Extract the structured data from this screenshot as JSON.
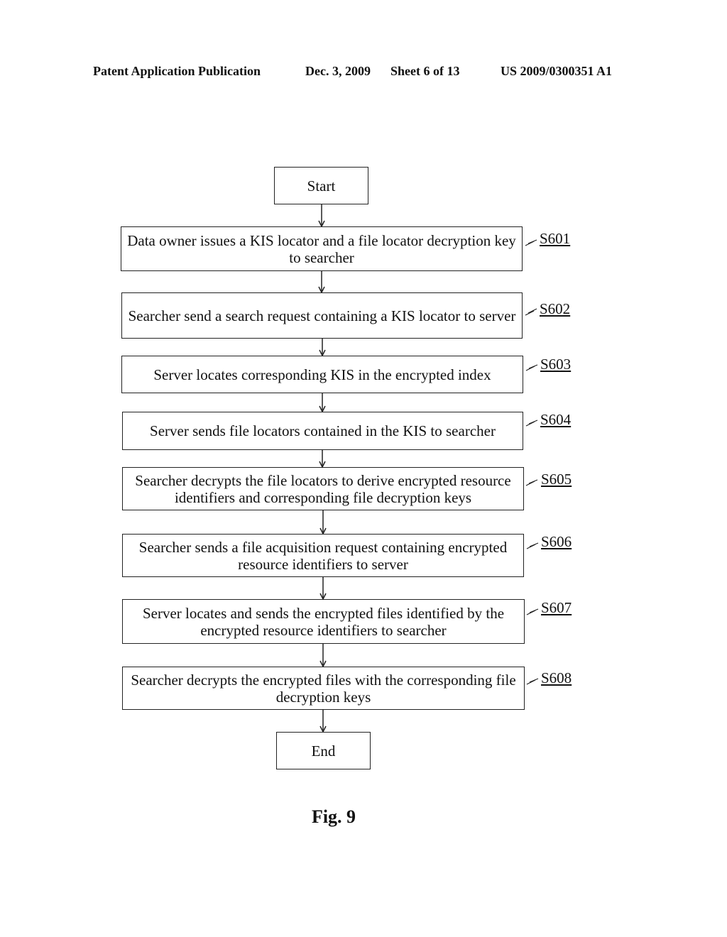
{
  "header": {
    "left": "Patent Application Publication",
    "date": "Dec. 3, 2009",
    "sheet": "Sheet 6 of 13",
    "number": "US 2009/0300351 A1"
  },
  "flowchart": {
    "start": "Start",
    "end": "End",
    "steps": [
      {
        "id": "S601",
        "text": "Data owner issues a KIS locator and a file locator decryption key to searcher"
      },
      {
        "id": "S602",
        "text": "Searcher send a search request containing a KIS locator to server"
      },
      {
        "id": "S603",
        "text": "Server locates corresponding KIS in the encrypted index"
      },
      {
        "id": "S604",
        "text": "Server sends file locators contained in the KIS to searcher"
      },
      {
        "id": "S605",
        "text": "Searcher decrypts the file locators to derive encrypted resource identifiers and corresponding file decryption keys"
      },
      {
        "id": "S606",
        "text": "Searcher sends a file acquisition request containing encrypted resource identifiers to server"
      },
      {
        "id": "S607",
        "text": "Server locates and sends the encrypted files identified by the encrypted resource identifiers to searcher"
      },
      {
        "id": "S608",
        "text": "Searcher decrypts the encrypted files with the corresponding file decryption keys"
      }
    ]
  },
  "figure_caption": "Fig. 9"
}
